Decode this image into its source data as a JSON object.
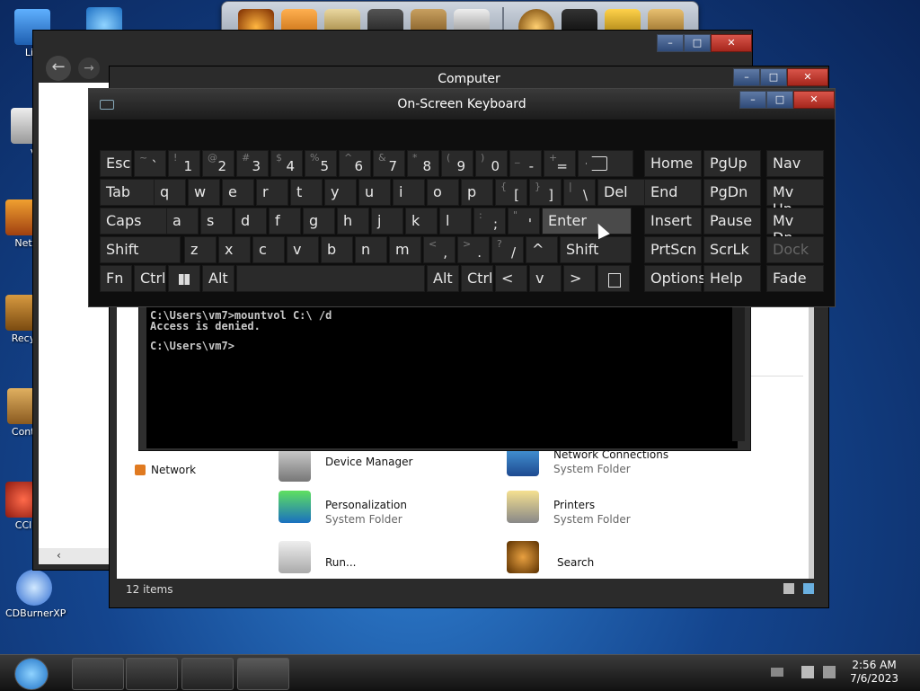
{
  "desktop": {
    "icons": [
      {
        "label": "Lib",
        "name": "libraries-icon"
      },
      {
        "label": "v",
        "name": "user-folder-icon"
      },
      {
        "label": "Net",
        "name": "network-desktop-icon"
      },
      {
        "label": "Recy",
        "name": "recycle-bin-icon"
      },
      {
        "label": "Contr",
        "name": "control-panel-icon"
      },
      {
        "label": "CCl",
        "name": "ccleaner-icon"
      },
      {
        "label": "CDBurnerXP",
        "name": "cdburnerxp-icon"
      }
    ]
  },
  "computer_window": {
    "title": "Computer",
    "nav_item": "Network",
    "status": "12 items",
    "items": [
      {
        "title": "Device Manager",
        "subtitle": ""
      },
      {
        "title": "Network Connections",
        "subtitle": "System Folder"
      },
      {
        "title": "Personalization",
        "subtitle": "System Folder"
      },
      {
        "title": "Printers",
        "subtitle": "System Folder"
      },
      {
        "title": "Run...",
        "subtitle": ""
      },
      {
        "title": "Search",
        "subtitle": ""
      }
    ]
  },
  "cmd": {
    "line1": "C:\\Users\\vm7>mountvol C:\\ /d",
    "line2": "Access is denied.",
    "line3": "C:\\Users\\vm7>"
  },
  "osk": {
    "title": "On-Screen Keyboard",
    "keys": {
      "esc": "Esc",
      "tab": "Tab",
      "caps": "Caps",
      "shift": "Shift",
      "fn": "Fn",
      "ctrl": "Ctrl",
      "alt": "Alt",
      "del": "Del",
      "enter": "Enter",
      "rshift": "Shift",
      "ralt": "Alt",
      "rctrl": "Ctrl",
      "home": "Home",
      "pgup": "PgUp",
      "nav": "Nav",
      "end": "End",
      "pgdn": "PgDn",
      "mvup": "Mv Up",
      "insert": "Insert",
      "pause": "Pause",
      "mvdn": "Mv Dn",
      "prtscn": "PrtScn",
      "scrlk": "ScrLk",
      "dock": "Dock",
      "options": "Options",
      "help": "Help",
      "fade": "Fade"
    },
    "row1": [
      {
        "sup": "~",
        "main": "`"
      },
      {
        "sup": "!",
        "main": "1"
      },
      {
        "sup": "@",
        "main": "2"
      },
      {
        "sup": "#",
        "main": "3"
      },
      {
        "sup": "$",
        "main": "4"
      },
      {
        "sup": "%",
        "main": "5"
      },
      {
        "sup": "^",
        "main": "6"
      },
      {
        "sup": "&",
        "main": "7"
      },
      {
        "sup": "*",
        "main": "8"
      },
      {
        "sup": "(",
        "main": "9"
      },
      {
        "sup": ")",
        "main": "0"
      },
      {
        "sup": "_",
        "main": "-"
      },
      {
        "sup": "+",
        "main": "="
      }
    ],
    "row2": [
      "q",
      "w",
      "e",
      "r",
      "t",
      "y",
      "u",
      "i",
      "o",
      "p"
    ],
    "row2_sym": [
      {
        "sup": "{",
        "main": "["
      },
      {
        "sup": "}",
        "main": "]"
      },
      {
        "sup": "|",
        "main": "\\"
      }
    ],
    "row3": [
      "a",
      "s",
      "d",
      "f",
      "g",
      "h",
      "j",
      "k",
      "l"
    ],
    "row3_sym": [
      {
        "sup": ":",
        "main": ";"
      },
      {
        "sup": "\"",
        "main": "'"
      }
    ],
    "row4": [
      "z",
      "x",
      "c",
      "v",
      "b",
      "n",
      "m"
    ],
    "row4_sym": [
      {
        "sup": "<",
        "main": ","
      },
      {
        "sup": ">",
        "main": "."
      },
      {
        "sup": "?",
        "main": "/"
      }
    ]
  },
  "taskbar": {
    "time": "2:56 AM",
    "date": "7/6/2023"
  }
}
